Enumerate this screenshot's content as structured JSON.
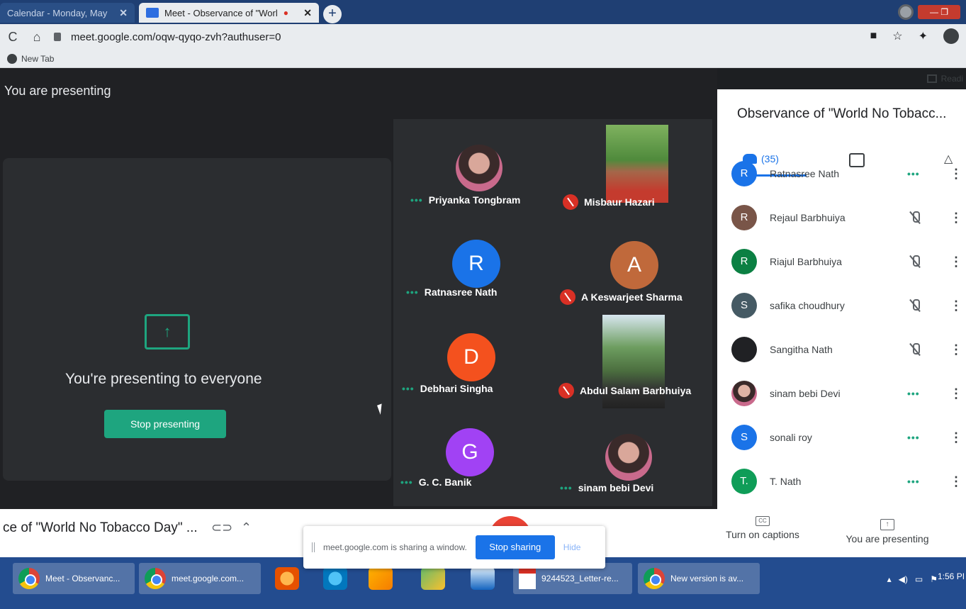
{
  "browser": {
    "tabs": [
      {
        "title": "Calendar - Monday, May",
        "active": false
      },
      {
        "title": "Meet - Observance of \"Worl",
        "active": true
      }
    ],
    "new_tab_symbol": "+",
    "url": "meet.google.com/oqw-qyqo-zvh?authuser=0",
    "bookmark": "New Tab",
    "reading_list": "Readi"
  },
  "meet": {
    "presenting_label": "You are presenting",
    "presenting_message": "You're presenting to everyone",
    "stop_presenting_label": "Stop presenting",
    "tiles": [
      {
        "name": "Priyanka Tongbram",
        "status": "speaking",
        "avatar": "photo"
      },
      {
        "name": "Misbaur Hazari",
        "status": "muted",
        "avatar": "video"
      },
      {
        "name": "Ratnasree Nath",
        "status": "speaking",
        "avatar": "letter",
        "letter": "R",
        "color": "#1a73e8"
      },
      {
        "name": "A Keswarjeet Sharma",
        "status": "muted",
        "avatar": "letter",
        "letter": "A",
        "color": "#c0693b"
      },
      {
        "name": "Debhari Singha",
        "status": "speaking",
        "avatar": "letter",
        "letter": "D",
        "color": "#f4511e"
      },
      {
        "name": "Abdul Salam Barbhuiya",
        "status": "muted",
        "avatar": "video"
      },
      {
        "name": "G. C. Banik",
        "status": "speaking",
        "avatar": "letter",
        "letter": "G",
        "color": "#a142f4"
      },
      {
        "name": "sinam bebi Devi",
        "status": "speaking",
        "avatar": "photo"
      }
    ],
    "speaking_dots": "•••"
  },
  "side_panel": {
    "title": "Observance of \"World No Tobacc...",
    "people_count": "(35)",
    "participants": [
      {
        "name": "Ratnasree Nath",
        "letter": "R",
        "color": "#1a73e8",
        "state": "speaking"
      },
      {
        "name": "Rejaul Barbhuiya",
        "letter": "R",
        "color": "#795548",
        "state": "muted"
      },
      {
        "name": "Riajul Barbhuiya",
        "letter": "R",
        "color": "#0b8043",
        "state": "muted"
      },
      {
        "name": "safika choudhury",
        "letter": "S",
        "color": "#455a64",
        "state": "muted"
      },
      {
        "name": "Sangitha Nath",
        "letter": "",
        "color": "#202124",
        "state": "muted"
      },
      {
        "name": "sinam bebi Devi",
        "letter": "",
        "color": "photo",
        "state": "speaking"
      },
      {
        "name": "sonali roy",
        "letter": "S",
        "color": "#1a73e8",
        "state": "speaking"
      },
      {
        "name": "T. Nath",
        "letter": "T.",
        "color": "#0f9d58",
        "state": "speaking"
      }
    ],
    "more_symbol": "⋮"
  },
  "bottom_bar": {
    "meeting_name": "ce of \"World No Tobacco Day\" ...",
    "share_notice": "meet.google.com is sharing a window.",
    "stop_sharing_label": "Stop sharing",
    "hide_label": "Hide",
    "captions_label": "Turn on captions",
    "captions_icon": "CC",
    "you_are_presenting_label": "You are presenting"
  },
  "taskbar": {
    "items": [
      {
        "label": "Meet - Observanc..."
      },
      {
        "label": "meet.google.com..."
      },
      {
        "label": "9244523_Letter-re..."
      },
      {
        "label": "New version is av..."
      }
    ],
    "clock": "1:56 PI"
  }
}
